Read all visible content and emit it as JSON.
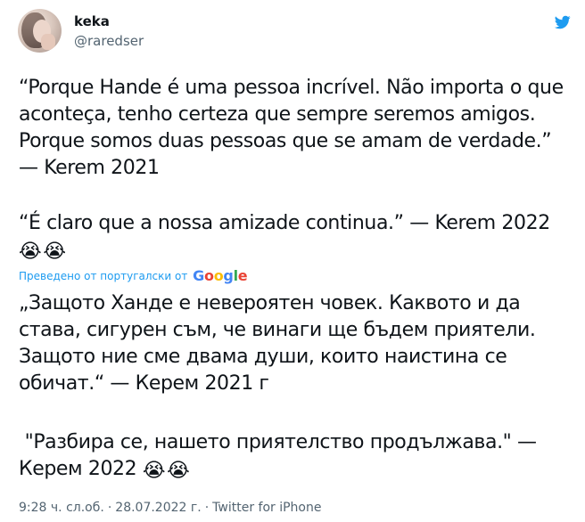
{
  "user": {
    "name": "keka",
    "handle": "@raredser",
    "avatar_icon": "profile-photo"
  },
  "icons": {
    "twitter_logo": "twitter-bird-icon",
    "crying_emoji": "loudly-crying-face-emoji"
  },
  "colors": {
    "link_blue": "#1d9bf0",
    "twitter_blue": "#1d9bf0",
    "secondary_text": "#536471"
  },
  "tweet": {
    "original_paragraph_1": "“Porque Hande é uma pessoa incrível. Não importa o que aconteça, tenho certeza que sempre seremos amigos. Porque somos duas pessoas que se amam de verdade.” — Kerem 2021",
    "original_paragraph_2": "“É claro que a nossa amizade continua.” — Kerem 2022",
    "emoji": "😭",
    "translated_label": "Преведено от португалски от",
    "google_letters": [
      "G",
      "o",
      "o",
      "g",
      "l",
      "e"
    ],
    "translated_paragraph_1": "„Защото Ханде е невероятен човек. Каквото и да става, сигурен съм, че винаги ще бъдем приятели. Защото ние сме двама души, които наистина се обичат.“ — Керем 2021 г",
    "translated_paragraph_2": " \"Разбира се, нашето приятелство продължава.\" — Керем 2022"
  },
  "footer": {
    "time": "9:28 ч.",
    "weekday": "сл.об.",
    "date": "28.07.2022 г.",
    "source": "Twitter for iPhone",
    "separator": "·"
  }
}
